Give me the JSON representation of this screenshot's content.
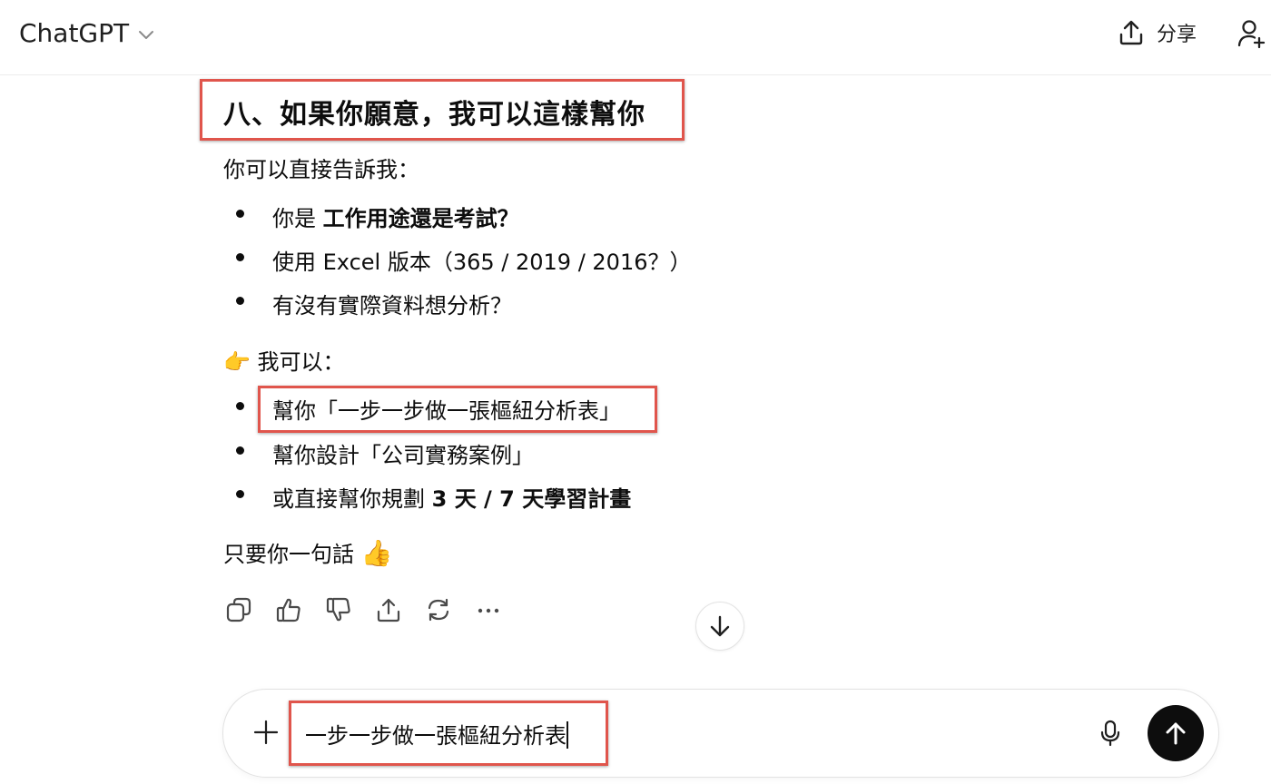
{
  "header": {
    "app_title": "ChatGPT",
    "share_label": "分享"
  },
  "message": {
    "heading": "八、如果你願意，我可以這樣幫你",
    "intro": "你可以直接告訴我：",
    "questions": [
      {
        "prefix": "你是 ",
        "bold": "工作用途還是考試？"
      },
      {
        "text": "使用 Excel 版本（365 / 2019 / 2016？）"
      },
      {
        "text": "有沒有實際資料想分析？"
      }
    ],
    "offer_emoji": "👉",
    "offer_label": "我可以：",
    "offers": [
      {
        "text": "幫你「一步一步做一張樞紐分析表」"
      },
      {
        "text": "幫你設計「公司實務案例」"
      },
      {
        "prefix": "或直接幫你規劃 ",
        "bold": "3 天 / 7 天學習計畫"
      }
    ],
    "closing": "只要你一句話",
    "closing_emoji": "👍"
  },
  "composer": {
    "value": "一步一步做一張樞紐分析表"
  },
  "colors": {
    "highlight_box": "#e0554c",
    "send_button": "#0d0d0d"
  }
}
